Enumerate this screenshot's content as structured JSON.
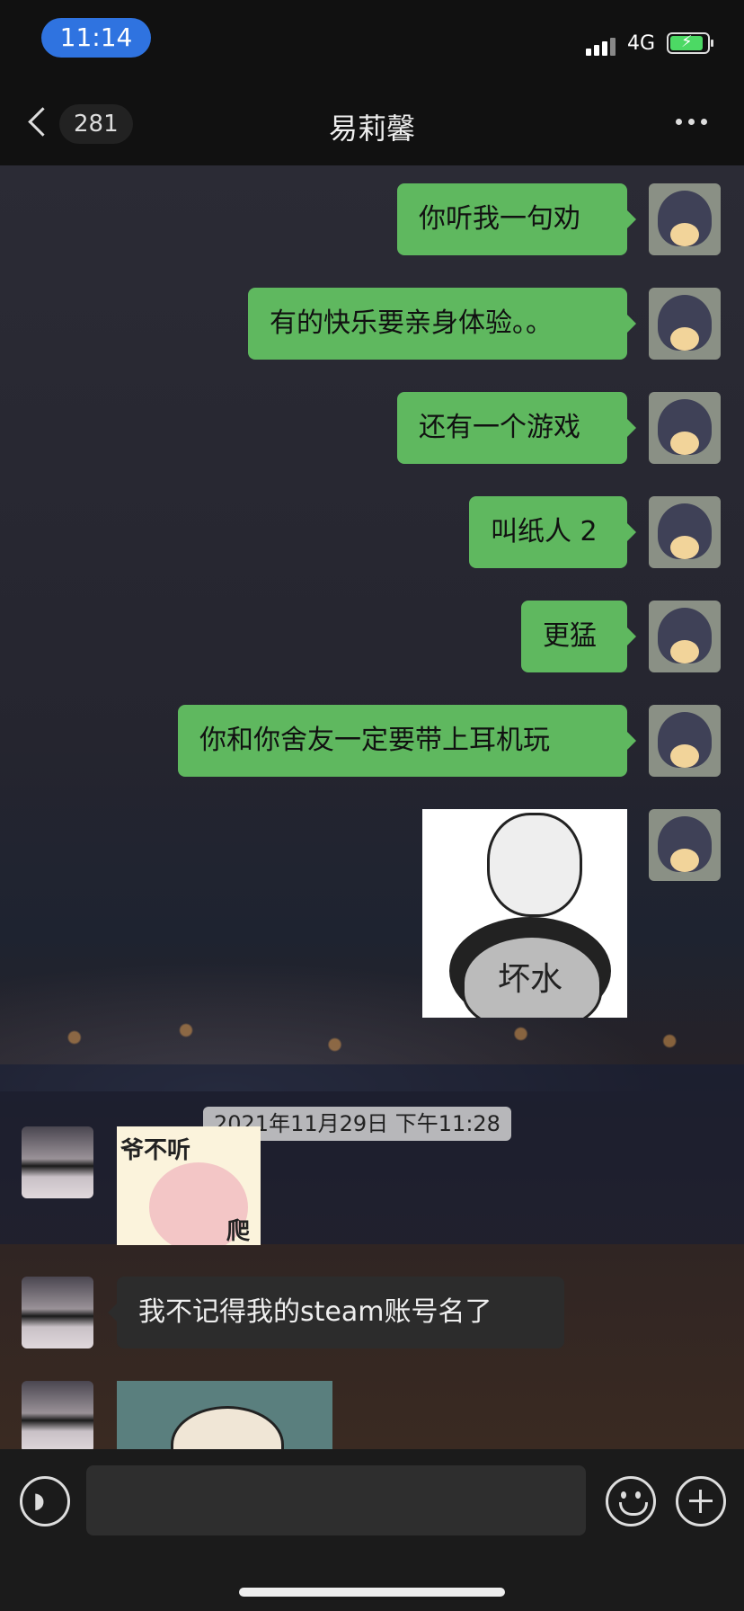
{
  "status_bar": {
    "time": "11:14",
    "network": "4G"
  },
  "nav": {
    "back_count": "281",
    "title": "易莉馨"
  },
  "messages_out": [
    {
      "text": "你听我一句劝"
    },
    {
      "text": "有的快乐要亲身体验。。"
    },
    {
      "text": "还有一个游戏"
    },
    {
      "text": "叫纸人 2"
    },
    {
      "text": "更猛"
    },
    {
      "text": "你和你舍友一定要带上耳机玩"
    }
  ],
  "stickers": {
    "panda_text": "坏水",
    "ye_text_top": "爷不听",
    "ye_text_bottom": "爬"
  },
  "timestamp": "2021年11月29日 下午11:28",
  "messages_in": [
    {
      "text": "我不记得我的steam账号名了"
    }
  ],
  "colors": {
    "bubble_out": "#5fb85f",
    "bubble_in": "#2c2c2c",
    "time_pill": "#2f73e0"
  }
}
